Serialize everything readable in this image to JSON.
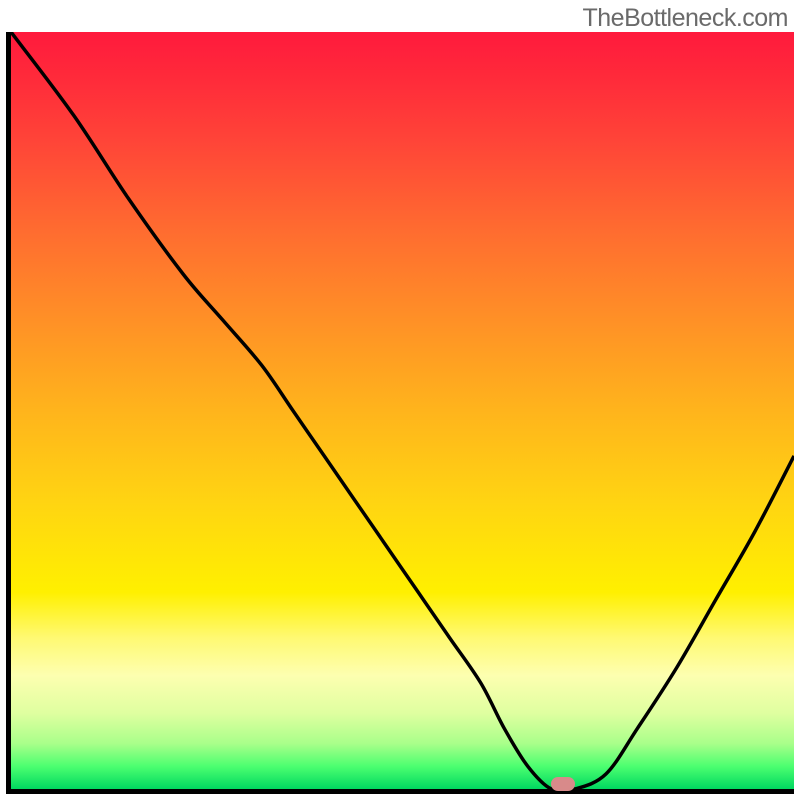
{
  "watermark": "TheBottleneck.com",
  "chart_data": {
    "type": "line",
    "title": "",
    "xlabel": "",
    "ylabel": "",
    "xlim": [
      0,
      100
    ],
    "ylim": [
      0,
      100
    ],
    "x": [
      0,
      8,
      15,
      22,
      27,
      32,
      36,
      40,
      44,
      48,
      52,
      56,
      60,
      63,
      66,
      69,
      72,
      76,
      80,
      85,
      90,
      95,
      100
    ],
    "values": [
      100,
      89,
      78,
      68,
      62,
      56,
      50,
      44,
      38,
      32,
      26,
      20,
      14,
      8,
      3,
      0,
      0,
      2,
      8,
      16,
      25,
      34,
      44
    ],
    "marker_x": 70,
    "annotations": []
  },
  "colors": {
    "axis": "#000000",
    "curve": "#000000",
    "marker": "#d88a8a",
    "watermark": "#6a6a6a"
  }
}
